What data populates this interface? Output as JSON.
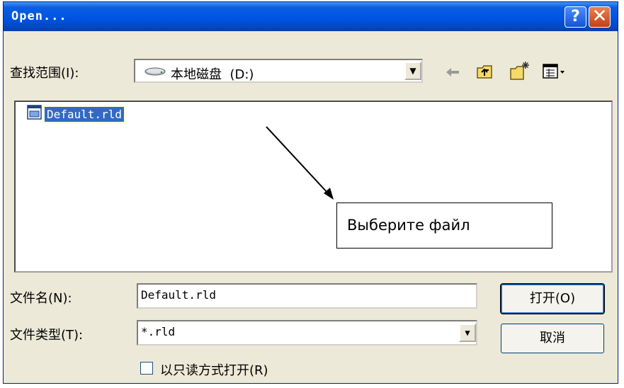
{
  "window": {
    "title": "Open...",
    "help_glyph": "?",
    "close_glyph": "✕"
  },
  "lookin": {
    "label": "查找范围(I):",
    "value": "本地磁盘  (D:)",
    "dropdown_glyph": "▼"
  },
  "toolbar": {
    "back_icon": "back-arrow-icon",
    "up_icon": "up-folder-icon",
    "new_folder_icon": "new-folder-icon",
    "view_icon": "view-menu-icon"
  },
  "files": [
    {
      "name": "Default.rld",
      "icon": "file-icon",
      "selected": true
    }
  ],
  "annotation": {
    "text": "Выберите файл"
  },
  "filename": {
    "label": "文件名(N):",
    "value": "Default.rld"
  },
  "filetype": {
    "label": "文件类型(T):",
    "value": "*.rld",
    "dropdown_glyph": "▼"
  },
  "readonly": {
    "label": "以只读方式打开(R)",
    "checked": false
  },
  "buttons": {
    "open": "打开(O)",
    "cancel": "取消"
  },
  "colors": {
    "title_bar": "#0054e3",
    "dialog_bg": "#ece9d8",
    "selection": "#316ac5"
  }
}
